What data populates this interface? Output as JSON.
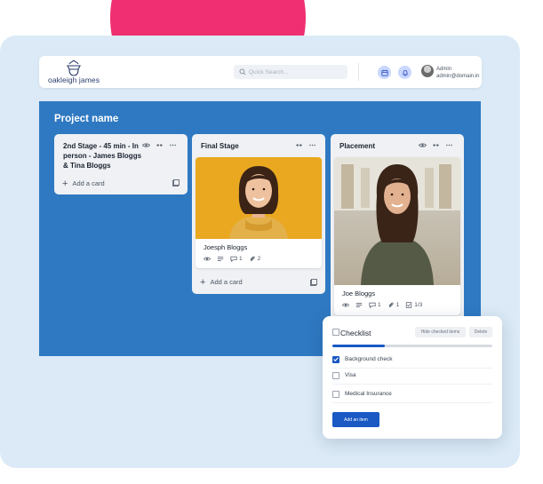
{
  "brand": {
    "logo_text": "oakleigh james"
  },
  "header": {
    "search_placeholder": "Quick Search...",
    "user": {
      "name": "Admin",
      "email": "admin@domain.in"
    }
  },
  "board": {
    "title": "Project name",
    "columns": [
      {
        "title": "2nd Stage - 45 min - In person - James Bloggs & Tina Bloggs",
        "add_card_label": "Add a card"
      },
      {
        "title": "Final Stage",
        "add_card_label": "Add a card",
        "card": {
          "title": "Joesph Bloggs",
          "comments": "1",
          "attachments": "2"
        }
      },
      {
        "title": "Placement",
        "card": {
          "title": "Joe Bloggs",
          "comments": "1",
          "attachments": "1",
          "checklist": "1/3"
        }
      }
    ]
  },
  "checklist": {
    "title": "Checklist",
    "hide_label": "Hide checked items",
    "delete_label": "Delete",
    "progress": 0.33,
    "items": [
      {
        "label": "Background check",
        "checked": true
      },
      {
        "label": "Visa",
        "checked": false
      },
      {
        "label": "Medical Insurance",
        "checked": false
      }
    ],
    "add_item_label": "Add an item"
  },
  "colors": {
    "board": "#2f79c2",
    "accent": "#1a58c4",
    "pink": "#ef2f72",
    "panel": "#dbeaf6"
  }
}
